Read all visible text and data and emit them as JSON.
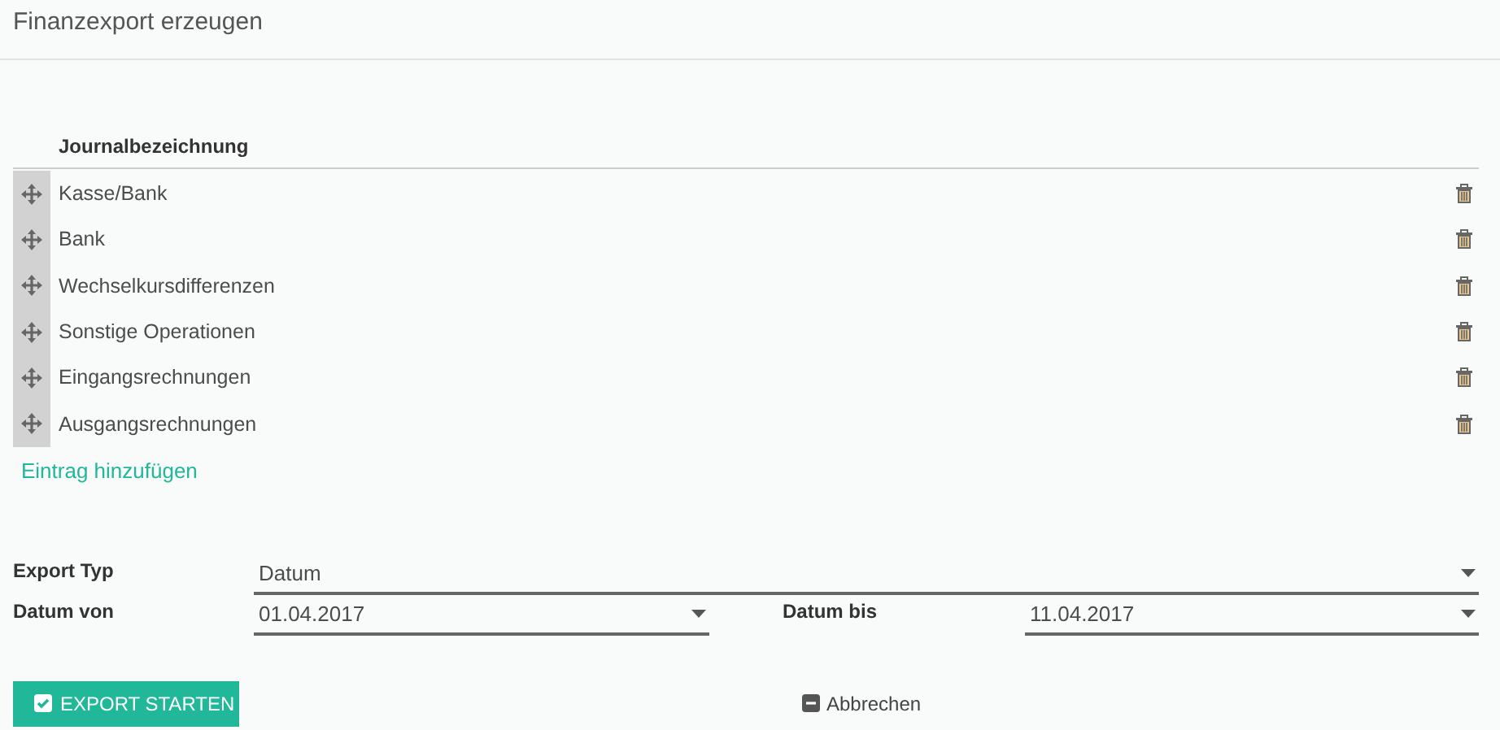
{
  "title": "Finanzexport erzeugen",
  "table": {
    "column": "Journalbezeichnung",
    "rows": [
      {
        "name": "Kasse/Bank"
      },
      {
        "name": "Bank"
      },
      {
        "name": "Wechselkursdifferenzen"
      },
      {
        "name": "Sonstige Operationen"
      },
      {
        "name": "Eingangsrechnungen"
      },
      {
        "name": "Ausgangsrechnungen"
      }
    ]
  },
  "add_link": "Eintrag hinzufügen",
  "export_type": {
    "label": "Export Typ",
    "value": "Datum"
  },
  "date_from": {
    "label": "Datum von",
    "value": "01.04.2017"
  },
  "date_to": {
    "label": "Datum bis",
    "value": "11.04.2017"
  },
  "buttons": {
    "start": "EXPORT STARTEN",
    "cancel": "Abbrechen"
  }
}
